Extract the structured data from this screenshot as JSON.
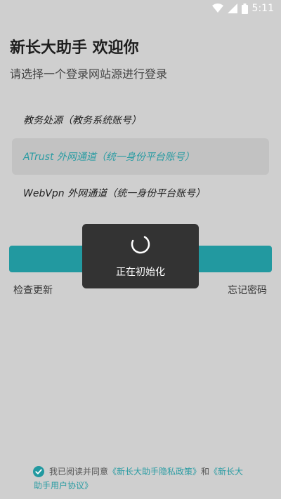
{
  "status_bar": {
    "time": "5:11",
    "icons": [
      "wifi-icon",
      "signal-icon",
      "battery-icon"
    ]
  },
  "header": {
    "title": "新长大助手 欢迎你",
    "subtitle": "请选择一个登录网站源进行登录"
  },
  "login_sources": [
    {
      "label": "教务处源（教务系统账号）",
      "selected": false
    },
    {
      "label": "ATrust 外网通道（统一身份平台账号）",
      "selected": true
    },
    {
      "label": "WebVpn 外网通道（统一身份平台账号）",
      "selected": false
    }
  ],
  "actions": {
    "check_update": "检查更新",
    "forgot_password": "忘记密码"
  },
  "toast": {
    "text": "正在初始化"
  },
  "agreement": {
    "checked": true,
    "prefix": "我已阅读并同意",
    "privacy_link": "《新长大助手隐私政策》",
    "conjunction": "和",
    "terms_link": "《新长大助手用户协议》"
  },
  "colors": {
    "accent": "#2299a0",
    "background": "#cfcfcf",
    "toast_bg": "#333333"
  }
}
